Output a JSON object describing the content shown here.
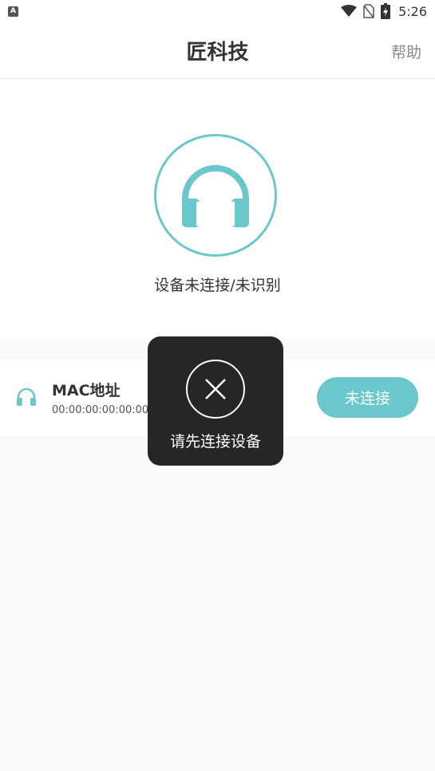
{
  "status_bar": {
    "notification_badge": "A",
    "time": "5:26",
    "icons": [
      "wifi-icon",
      "no-sim-icon",
      "battery-charging-icon"
    ]
  },
  "header": {
    "title": "匠科技",
    "help_label": "帮助"
  },
  "hero": {
    "icon": "headphones-icon",
    "status_text": "设备未连接/未识别"
  },
  "device": {
    "icon": "headphones-icon",
    "mac_label": "MAC地址",
    "mac_value": "00:00:00:00:00:00",
    "connect_label": "未连接"
  },
  "toast": {
    "icon": "close-icon",
    "message": "请先连接设备"
  },
  "colors": {
    "accent": "#6ac8cc",
    "toast_bg": "#262626",
    "page_bg": "#f9f9f9"
  }
}
